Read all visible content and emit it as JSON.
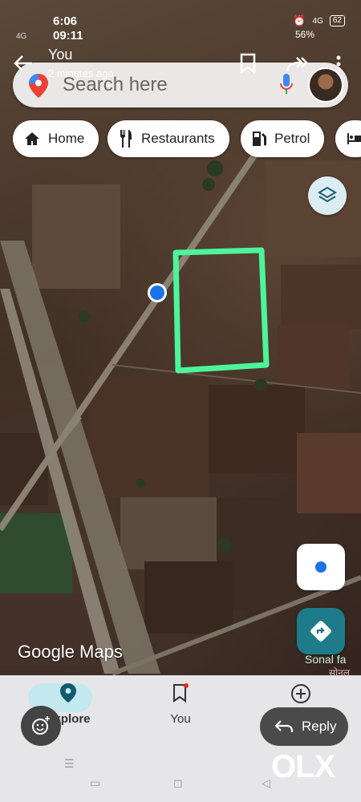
{
  "status": {
    "time": "6:06",
    "sub_time": "09:11",
    "network_left": "4G",
    "battery": "62",
    "battery_pct": "56%",
    "network_right": "4G"
  },
  "header": {
    "title": "You",
    "subtitle": "2 minutes ago"
  },
  "search": {
    "placeholder": "Search here"
  },
  "chips": [
    {
      "label": "Home"
    },
    {
      "label": "Restaurants"
    },
    {
      "label": "Petrol"
    }
  ],
  "brand": "Google Maps",
  "place_label": "Sonal fa",
  "place_label_local": "सोनल",
  "bottom_nav": {
    "items": [
      {
        "label": "Explore"
      },
      {
        "label": "You"
      },
      {
        "label": ""
      }
    ]
  },
  "reply": {
    "label": "Reply"
  },
  "olx": "OLX",
  "colors": {
    "plot_outline": "#4cf59a",
    "location_dot": "#1a73e8",
    "directions": "#1e7b8a",
    "chip_bg": "#ffffff"
  }
}
